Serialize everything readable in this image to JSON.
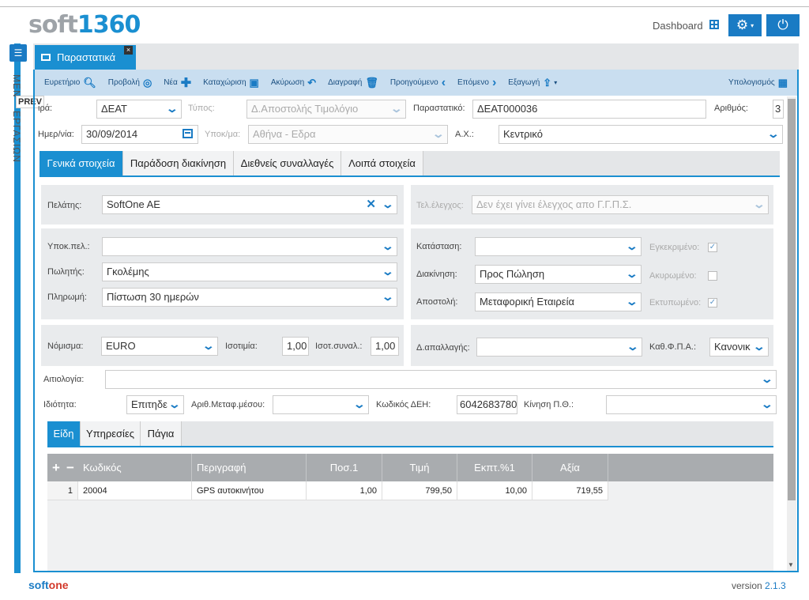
{
  "logo": {
    "part1": "soft",
    "part2": "1360"
  },
  "header": {
    "dashboard_label": "Dashboard"
  },
  "sidebar": {
    "menu_text": "ΜΕΝ",
    "work_text": "ΕΡΓΑΣΙΩΝ",
    "prev_label": "PREV"
  },
  "doc_tab": {
    "label": "Παραστατικά",
    "close": "×"
  },
  "toolbar": {
    "items": [
      "Ευρετήριο",
      "Προβολή",
      "Νέα",
      "Καταχώριση",
      "Ακύρωση",
      "Διαγραφή",
      "Προηγούμενο",
      "Επόμενο",
      "Εξαγωγή"
    ],
    "calc": "Υπολογισμός"
  },
  "form": {
    "seira_label": "ιρά:",
    "seira_value": "ΔΕΑΤ",
    "typos_label": "Τύπος:",
    "typos_value": "Δ.Αποστολής Τιμολόγιο",
    "parastatiko_label": "Παραστατικό:",
    "parastatiko_value": "ΔΕΑΤ000036",
    "arithmos_label": "Αριθμός:",
    "arithmos_value": "3",
    "date_label": "Ημερ/νία:",
    "date_value": "30/09/2014",
    "ypokatastima_label": "Υποκ/μα:",
    "ypokatastima_value": "Αθήνα - Εδρα",
    "ax_label": "Α.Χ.:",
    "ax_value": "Κεντρικό"
  },
  "main_tabs": [
    "Γενικά στοιχεία",
    "Παράδοση διακίνηση",
    "Διεθνείς συναλλαγές",
    "Λοιπά στοιχεία"
  ],
  "general": {
    "customer_label": "Πελάτης:",
    "customer_value": "SoftOne AE",
    "tel_label": "Τελ.έλεγχος:",
    "tel_value": "Δεν έχει γίνει έλεγχος απο Γ.Γ.Π.Σ.",
    "ypok_pel_label": "Υποκ.πελ.:",
    "ypok_pel_value": "",
    "seller_label": "Πωλητής:",
    "seller_value": "Γκολέμης",
    "payment_label": "Πληρωμή:",
    "payment_value": "Πίστωση 30 ημερών",
    "status_label": "Κατάσταση:",
    "status_value": "",
    "diakinisi_label": "Διακίνηση:",
    "diakinisi_value": "Προς Πώληση",
    "apostoli_label": "Αποστολή:",
    "apostoli_value": "Μεταφορική Εταιρεία",
    "approved_label": "Εγκεκριμένο:",
    "cancelled_label": "Ακυρωμένο:",
    "printed_label": "Εκτυπωμένο:",
    "currency_label": "Νόμισμα:",
    "currency_value": "EURO",
    "isotimia_label": "Ισοτιμία:",
    "isotimia_value": "1,00",
    "isot_syn_label": "Ισοτ.συναλ.:",
    "isot_syn_value": "1,00",
    "apallagi_label": "Δ.απαλλαγής:",
    "apallagi_value": "",
    "fpa_label": "Καθ.Φ.Π.Α.:",
    "fpa_value": "Κανονικ",
    "aitiologia_label": "Αιτιολογία:",
    "aitiologia_value": "",
    "idiotita_label": "Ιδιότητα:",
    "idiotita_value": "Επιτηδε",
    "arith_metaf_label": "Αριθ.Μεταφ.μέσου:",
    "arith_metaf_value": "",
    "kodikos_dei_label": "Κωδικός ΔΕΗ:",
    "kodikos_dei_value": "6042683780",
    "kinisi_label": "Κίνηση Π.Θ.:",
    "kinisi_value": ""
  },
  "lines_tabs": [
    "Είδη",
    "Υπηρεσίες",
    "Πάγια"
  ],
  "grid": {
    "add": "+",
    "remove": "−",
    "columns": [
      "Κωδικός",
      "Περιγραφή",
      "Ποσ.1",
      "Τιμή",
      "Εκπτ.%1",
      "Αξία"
    ],
    "rows": [
      [
        "1",
        "20004",
        "GPS αυτοκινήτου",
        "1,00",
        "799,50",
        "10,00",
        "719,55"
      ]
    ]
  },
  "footer": {
    "brand_soft": "soft",
    "brand_one": "one",
    "version_label": "version",
    "version_value": "2.1.3"
  },
  "colors": {
    "accent": "#1a8fd1",
    "toolbar_bg": "#c9def0",
    "brand_red": "#d2382a"
  }
}
